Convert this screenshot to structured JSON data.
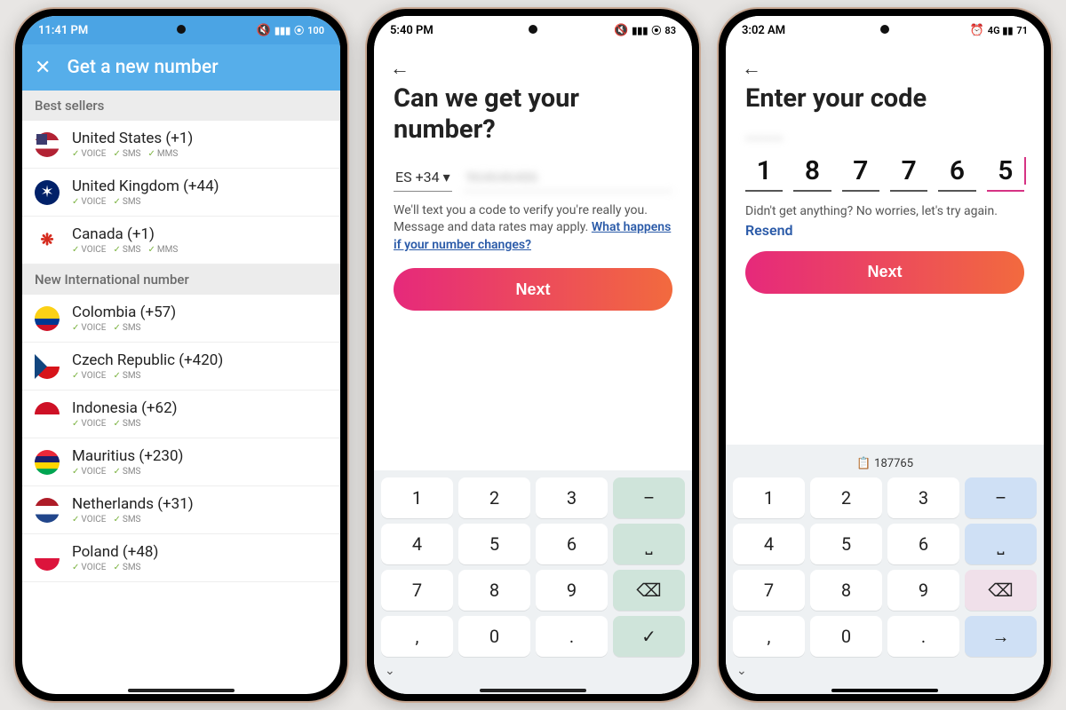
{
  "phone1": {
    "status": {
      "time": "11:41 PM",
      "battery": "100"
    },
    "title": "Get a new number",
    "sections": [
      {
        "header": "Best sellers",
        "countries": [
          {
            "name": "United States (+1)",
            "caps": [
              "VOICE",
              "SMS",
              "MMS"
            ],
            "flag": "us"
          },
          {
            "name": "United Kingdom (+44)",
            "caps": [
              "VOICE",
              "SMS"
            ],
            "flag": "uk"
          },
          {
            "name": "Canada (+1)",
            "caps": [
              "VOICE",
              "SMS",
              "MMS"
            ],
            "flag": "ca"
          }
        ]
      },
      {
        "header": "New International number",
        "countries": [
          {
            "name": "Colombia (+57)",
            "caps": [
              "VOICE",
              "SMS"
            ],
            "flag": "co"
          },
          {
            "name": "Czech Republic (+420)",
            "caps": [
              "VOICE",
              "SMS"
            ],
            "flag": "cz"
          },
          {
            "name": "Indonesia (+62)",
            "caps": [
              "VOICE",
              "SMS"
            ],
            "flag": "id"
          },
          {
            "name": "Mauritius (+230)",
            "caps": [
              "VOICE",
              "SMS"
            ],
            "flag": "mu"
          },
          {
            "name": "Netherlands (+31)",
            "caps": [
              "VOICE",
              "SMS"
            ],
            "flag": "nl"
          },
          {
            "name": "Poland (+48)",
            "caps": [
              "VOICE",
              "SMS"
            ],
            "flag": "pl"
          }
        ]
      }
    ]
  },
  "phone2": {
    "status": {
      "time": "5:40 PM",
      "battery": "83"
    },
    "title": "Can we get your number?",
    "country_code": "ES +34",
    "info_text": "We'll text you a code to verify you're really you. Message and data rates may apply. ",
    "link_text": "What happens if your number changes?",
    "next_label": "Next",
    "keyboard": {
      "keys": [
        "1",
        "2",
        "3",
        "–",
        "4",
        "5",
        "6",
        "⎵",
        "7",
        "8",
        "9",
        "⌫",
        ",",
        "0",
        ".",
        "✓"
      ]
    }
  },
  "phone3": {
    "status": {
      "time": "3:02 AM",
      "battery": "71"
    },
    "title": "Enter your code",
    "code": [
      "1",
      "8",
      "7",
      "7",
      "6",
      "5"
    ],
    "resend_text": "Didn't get anything? No worries, let's try again.",
    "resend_label": "Resend",
    "next_label": "Next",
    "suggestion": "187765",
    "keyboard": {
      "keys": [
        "1",
        "2",
        "3",
        "–",
        "4",
        "5",
        "6",
        "⎵",
        "7",
        "8",
        "9",
        "⌫",
        ",",
        "0",
        ".",
        "→"
      ]
    }
  }
}
